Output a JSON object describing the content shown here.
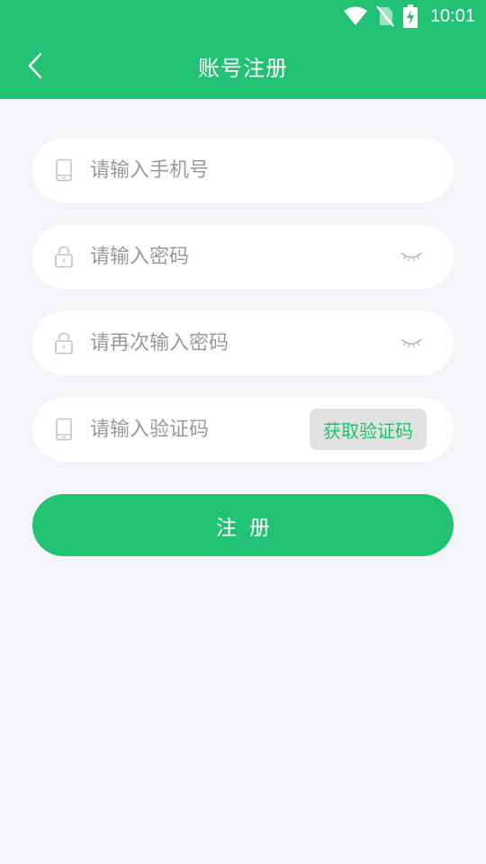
{
  "status_bar": {
    "time": "10:01",
    "icons": [
      "wifi-icon",
      "no-sim-icon",
      "battery-charging-icon"
    ]
  },
  "header": {
    "title": "账号注册",
    "back_icon": "chevron-left-icon"
  },
  "form": {
    "phone": {
      "placeholder": "请输入手机号",
      "value": "",
      "icon": "phone-icon"
    },
    "password": {
      "placeholder": "请输入密码",
      "value": "",
      "icon": "lock-icon",
      "toggle_icon": "eye-closed-icon"
    },
    "confirm_password": {
      "placeholder": "请再次输入密码",
      "value": "",
      "icon": "lock-icon",
      "toggle_icon": "eye-closed-icon"
    },
    "code": {
      "placeholder": "请输入验证码",
      "value": "",
      "icon": "phone-icon",
      "button_label": "获取验证码"
    }
  },
  "submit": {
    "label": "注册"
  },
  "colors": {
    "accent": "#22c275",
    "background": "#f3f5f9",
    "field_bg": "#ffffff",
    "code_button_bg": "#e1e1e1",
    "placeholder": "#9a9a9a"
  }
}
